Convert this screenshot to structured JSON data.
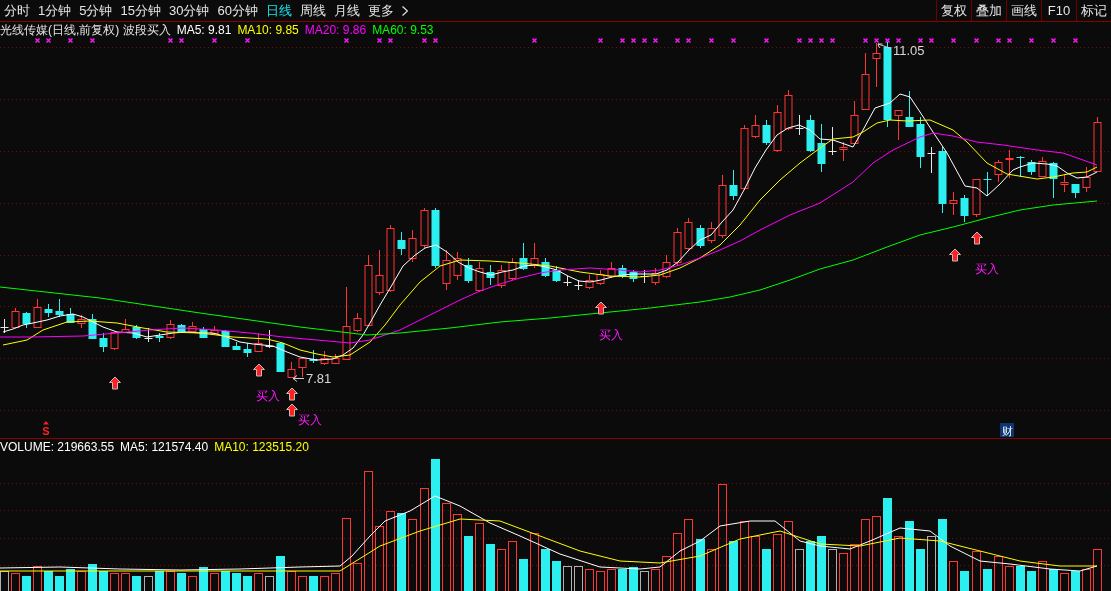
{
  "toolbar": {
    "period_tabs": [
      {
        "label": "分时",
        "selected": false
      },
      {
        "label": "1分钟",
        "selected": false
      },
      {
        "label": "5分钟",
        "selected": false
      },
      {
        "label": "15分钟",
        "selected": false
      },
      {
        "label": "30分钟",
        "selected": false
      },
      {
        "label": "60分钟",
        "selected": false
      },
      {
        "label": "日线",
        "selected": true
      },
      {
        "label": "周线",
        "selected": false
      },
      {
        "label": "月线",
        "selected": false
      }
    ],
    "more_menu": {
      "label": "更多"
    },
    "buttons": [
      "复权",
      "叠加",
      "画线",
      "F10",
      "标记"
    ]
  },
  "price_panel": {
    "title": "光线传媒(日线,前复权) 波段买入",
    "indicators": [
      {
        "label": "MA5: 9.81",
        "color": "#ffffff"
      },
      {
        "label": "MA10: 9.85",
        "color": "#ffff00"
      },
      {
        "label": "MA20: 9.86",
        "color": "#ff00ff"
      },
      {
        "label": "MA60: 9.53",
        "color": "#00ff00"
      }
    ],
    "high_label": "11.05",
    "low_label": "7.81",
    "signal_labels": [
      "买入",
      "买入",
      "买入",
      "买入"
    ],
    "signal_letter": "S",
    "finance_badge": "财"
  },
  "volume_panel": {
    "indicators": [
      {
        "label": "VOLUME: 219663.55",
        "color": "#ffffff"
      },
      {
        "label": "MA5: 121574.40",
        "color": "#ffffff"
      },
      {
        "label": "MA10: 123515.20",
        "color": "#ffff00"
      }
    ]
  }
}
